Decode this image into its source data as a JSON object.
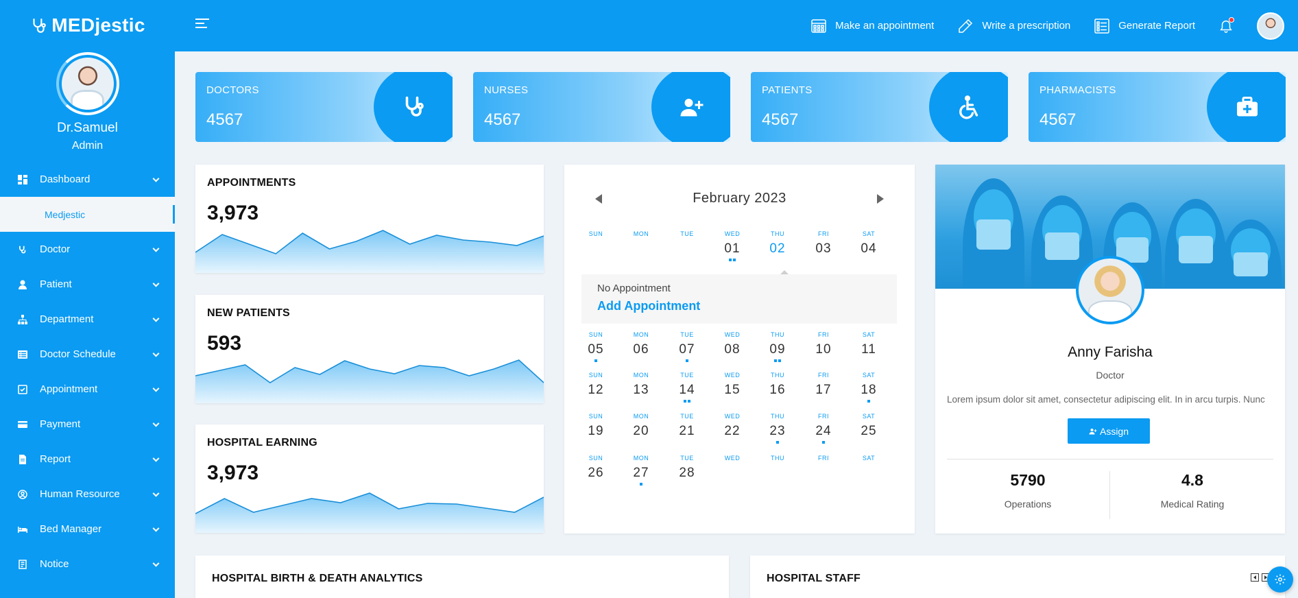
{
  "brand": {
    "name": "MEDjestic"
  },
  "profile": {
    "name": "Dr.Samuel",
    "role": "Admin"
  },
  "sidebar": {
    "items": [
      {
        "label": "Dashboard",
        "icon": "dashboard-icon",
        "expanded": true,
        "sub": [
          {
            "label": "Medjestic",
            "active": true
          }
        ]
      },
      {
        "label": "Doctor",
        "icon": "stethoscope-icon"
      },
      {
        "label": "Patient",
        "icon": "user-icon"
      },
      {
        "label": "Department",
        "icon": "sitemap-icon"
      },
      {
        "label": "Doctor Schedule",
        "icon": "list-icon"
      },
      {
        "label": "Appointment",
        "icon": "calendar-check-icon"
      },
      {
        "label": "Payment",
        "icon": "credit-card-icon"
      },
      {
        "label": "Report",
        "icon": "file-icon"
      },
      {
        "label": "Human Resource",
        "icon": "user-circle-icon"
      },
      {
        "label": "Bed Manager",
        "icon": "bed-icon"
      },
      {
        "label": "Notice",
        "icon": "notice-icon"
      }
    ]
  },
  "topbar": {
    "actions": [
      {
        "label": "Make an appointment",
        "icon": "calendar-grid-icon"
      },
      {
        "label": "Write a prescription",
        "icon": "pencil-icon"
      },
      {
        "label": "Generate Report",
        "icon": "report-list-icon"
      }
    ],
    "notification_icon": "bell-icon",
    "notification_badge": true
  },
  "stats": [
    {
      "label": "DOCTORS",
      "value": "4567",
      "icon": "stethoscope-icon"
    },
    {
      "label": "NURSES",
      "value": "4567",
      "icon": "user-plus-icon"
    },
    {
      "label": "PATIENTS",
      "value": "4567",
      "icon": "wheelchair-icon"
    },
    {
      "label": "PHARMACISTS",
      "value": "4567",
      "icon": "medkit-icon"
    }
  ],
  "mini_cards": [
    {
      "title": "APPOINTMENTS",
      "value": "3,973",
      "trend": [
        30,
        56,
        42,
        28,
        58,
        35,
        46,
        62,
        42,
        55,
        48,
        45,
        40,
        54
      ]
    },
    {
      "title": "NEW PATIENTS",
      "value": "593",
      "trend": [
        40,
        48,
        56,
        30,
        52,
        42,
        62,
        50,
        43,
        55,
        52,
        40,
        50,
        63,
        30
      ]
    },
    {
      "title": "HOSPITAL EARNING",
      "value": "3,973",
      "trend": [
        28,
        50,
        30,
        40,
        50,
        44,
        58,
        35,
        43,
        42,
        36,
        30,
        52
      ]
    }
  ],
  "calendar": {
    "month_label": "February 2023",
    "dow": [
      "SUN",
      "MON",
      "TUE",
      "WED",
      "THU",
      "FRI",
      "SAT"
    ],
    "weeks": [
      [
        {
          "d": ""
        },
        {
          "d": ""
        },
        {
          "d": ""
        },
        {
          "d": "01",
          "dots": 2
        },
        {
          "d": "02",
          "active": true
        },
        {
          "d": "03"
        },
        {
          "d": "04"
        }
      ],
      [
        {
          "d": "05",
          "dots": 1
        },
        {
          "d": "06"
        },
        {
          "d": "07",
          "dots": 1
        },
        {
          "d": "08"
        },
        {
          "d": "09",
          "dots": 2
        },
        {
          "d": "10"
        },
        {
          "d": "11"
        }
      ],
      [
        {
          "d": "12"
        },
        {
          "d": "13"
        },
        {
          "d": "14",
          "dots": 2
        },
        {
          "d": "15"
        },
        {
          "d": "16"
        },
        {
          "d": "17"
        },
        {
          "d": "18",
          "dots": 1
        }
      ],
      [
        {
          "d": "19"
        },
        {
          "d": "20"
        },
        {
          "d": "21"
        },
        {
          "d": "22"
        },
        {
          "d": "23",
          "dots": 1
        },
        {
          "d": "24",
          "dots": 1
        },
        {
          "d": "25"
        }
      ],
      [
        {
          "d": "26"
        },
        {
          "d": "27",
          "dots": 1
        },
        {
          "d": "28"
        },
        {
          "d": ""
        },
        {
          "d": ""
        },
        {
          "d": ""
        },
        {
          "d": ""
        }
      ]
    ],
    "popup": {
      "text": "No Appointment",
      "link": "Add Appointment"
    }
  },
  "doctor_card": {
    "name": "Anny Farisha",
    "role": "Doctor",
    "bio": "Lorem ipsum dolor sit amet, consectetur adipiscing elit. In in arcu turpis. Nunc",
    "assign_label": "Assign",
    "stats": [
      {
        "value": "5790",
        "label": "Operations"
      },
      {
        "value": "4.8",
        "label": "Medical Rating"
      }
    ]
  },
  "bottom": {
    "left_title": "HOSPITAL BIRTH & DEATH ANALYTICS",
    "right_title": "HOSPITAL STAFF"
  },
  "colors": {
    "primary": "#0b9bf2",
    "background": "#eef3f8",
    "accent_light": "#d6efff"
  }
}
